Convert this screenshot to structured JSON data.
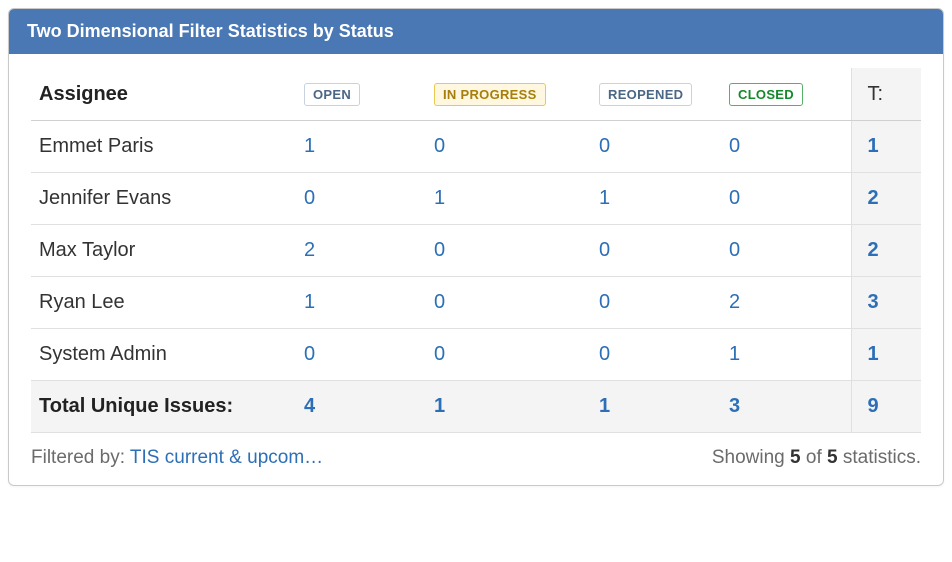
{
  "header": {
    "title": "Two Dimensional Filter Statistics by Status"
  },
  "table": {
    "row_header": "Assignee",
    "total_header": "T:",
    "statuses": [
      {
        "key": "open",
        "label": "OPEN",
        "css": "status-open"
      },
      {
        "key": "progress",
        "label": "IN PROGRESS",
        "css": "status-progress"
      },
      {
        "key": "reopened",
        "label": "REOPENED",
        "css": "status-reopened"
      },
      {
        "key": "closed",
        "label": "CLOSED",
        "css": "status-closed"
      }
    ],
    "rows": [
      {
        "name": "Emmet Paris",
        "values": [
          1,
          0,
          0,
          0
        ],
        "total": 1
      },
      {
        "name": "Jennifer Evans",
        "values": [
          0,
          1,
          1,
          0
        ],
        "total": 2
      },
      {
        "name": "Max Taylor",
        "values": [
          2,
          0,
          0,
          0
        ],
        "total": 2
      },
      {
        "name": "Ryan Lee",
        "values": [
          1,
          0,
          0,
          2
        ],
        "total": 3
      },
      {
        "name": "System Admin",
        "values": [
          0,
          0,
          0,
          1
        ],
        "total": 1
      }
    ],
    "totals": {
      "label": "Total Unique Issues:",
      "values": [
        4,
        1,
        1,
        3
      ],
      "total": 9
    }
  },
  "footer": {
    "filtered_by_prefix": "Filtered by: ",
    "filter_name": "TIS current & upcom…",
    "showing_prefix": "Showing ",
    "count_shown": "5",
    "showing_of": " of ",
    "count_total": "5",
    "showing_suffix": " statistics."
  }
}
